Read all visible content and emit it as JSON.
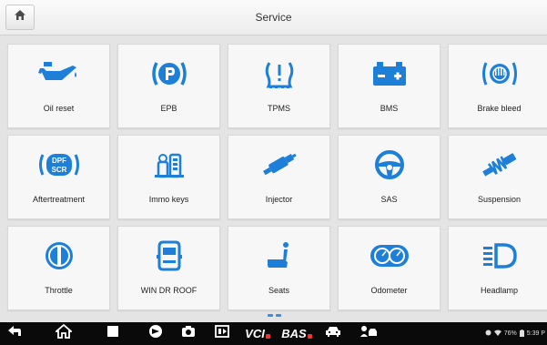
{
  "header": {
    "title": "Service"
  },
  "tiles": [
    {
      "label": "Oil reset",
      "icon": "oil-can-icon"
    },
    {
      "label": "EPB",
      "icon": "parking-brake-icon"
    },
    {
      "label": "TPMS",
      "icon": "tire-pressure-icon"
    },
    {
      "label": "BMS",
      "icon": "battery-icon"
    },
    {
      "label": "Brake bleed",
      "icon": "brake-bleed-icon"
    },
    {
      "label": "Aftertreatment",
      "icon": "dpf-scr-icon",
      "icon_text_top": "DPF",
      "icon_text_bottom": "SCR"
    },
    {
      "label": "Immo keys",
      "icon": "immo-keys-icon"
    },
    {
      "label": "Injector",
      "icon": "injector-icon"
    },
    {
      "label": "SAS",
      "icon": "steering-wheel-icon"
    },
    {
      "label": "Suspension",
      "icon": "suspension-icon"
    },
    {
      "label": "Throttle",
      "icon": "throttle-icon"
    },
    {
      "label": "WIN DR ROOF",
      "icon": "car-door-icon"
    },
    {
      "label": "Seats",
      "icon": "seat-icon"
    },
    {
      "label": "Odometer",
      "icon": "odometer-icon"
    },
    {
      "label": "Headlamp",
      "icon": "headlamp-icon"
    }
  ],
  "navbar": {
    "vci_label": "VCI",
    "bas_label": "BAS",
    "battery_percent": "76%",
    "time": "5:39 P"
  },
  "colors": {
    "icon_blue": "#1e7fd8",
    "navbar": "#0a0a0a"
  }
}
